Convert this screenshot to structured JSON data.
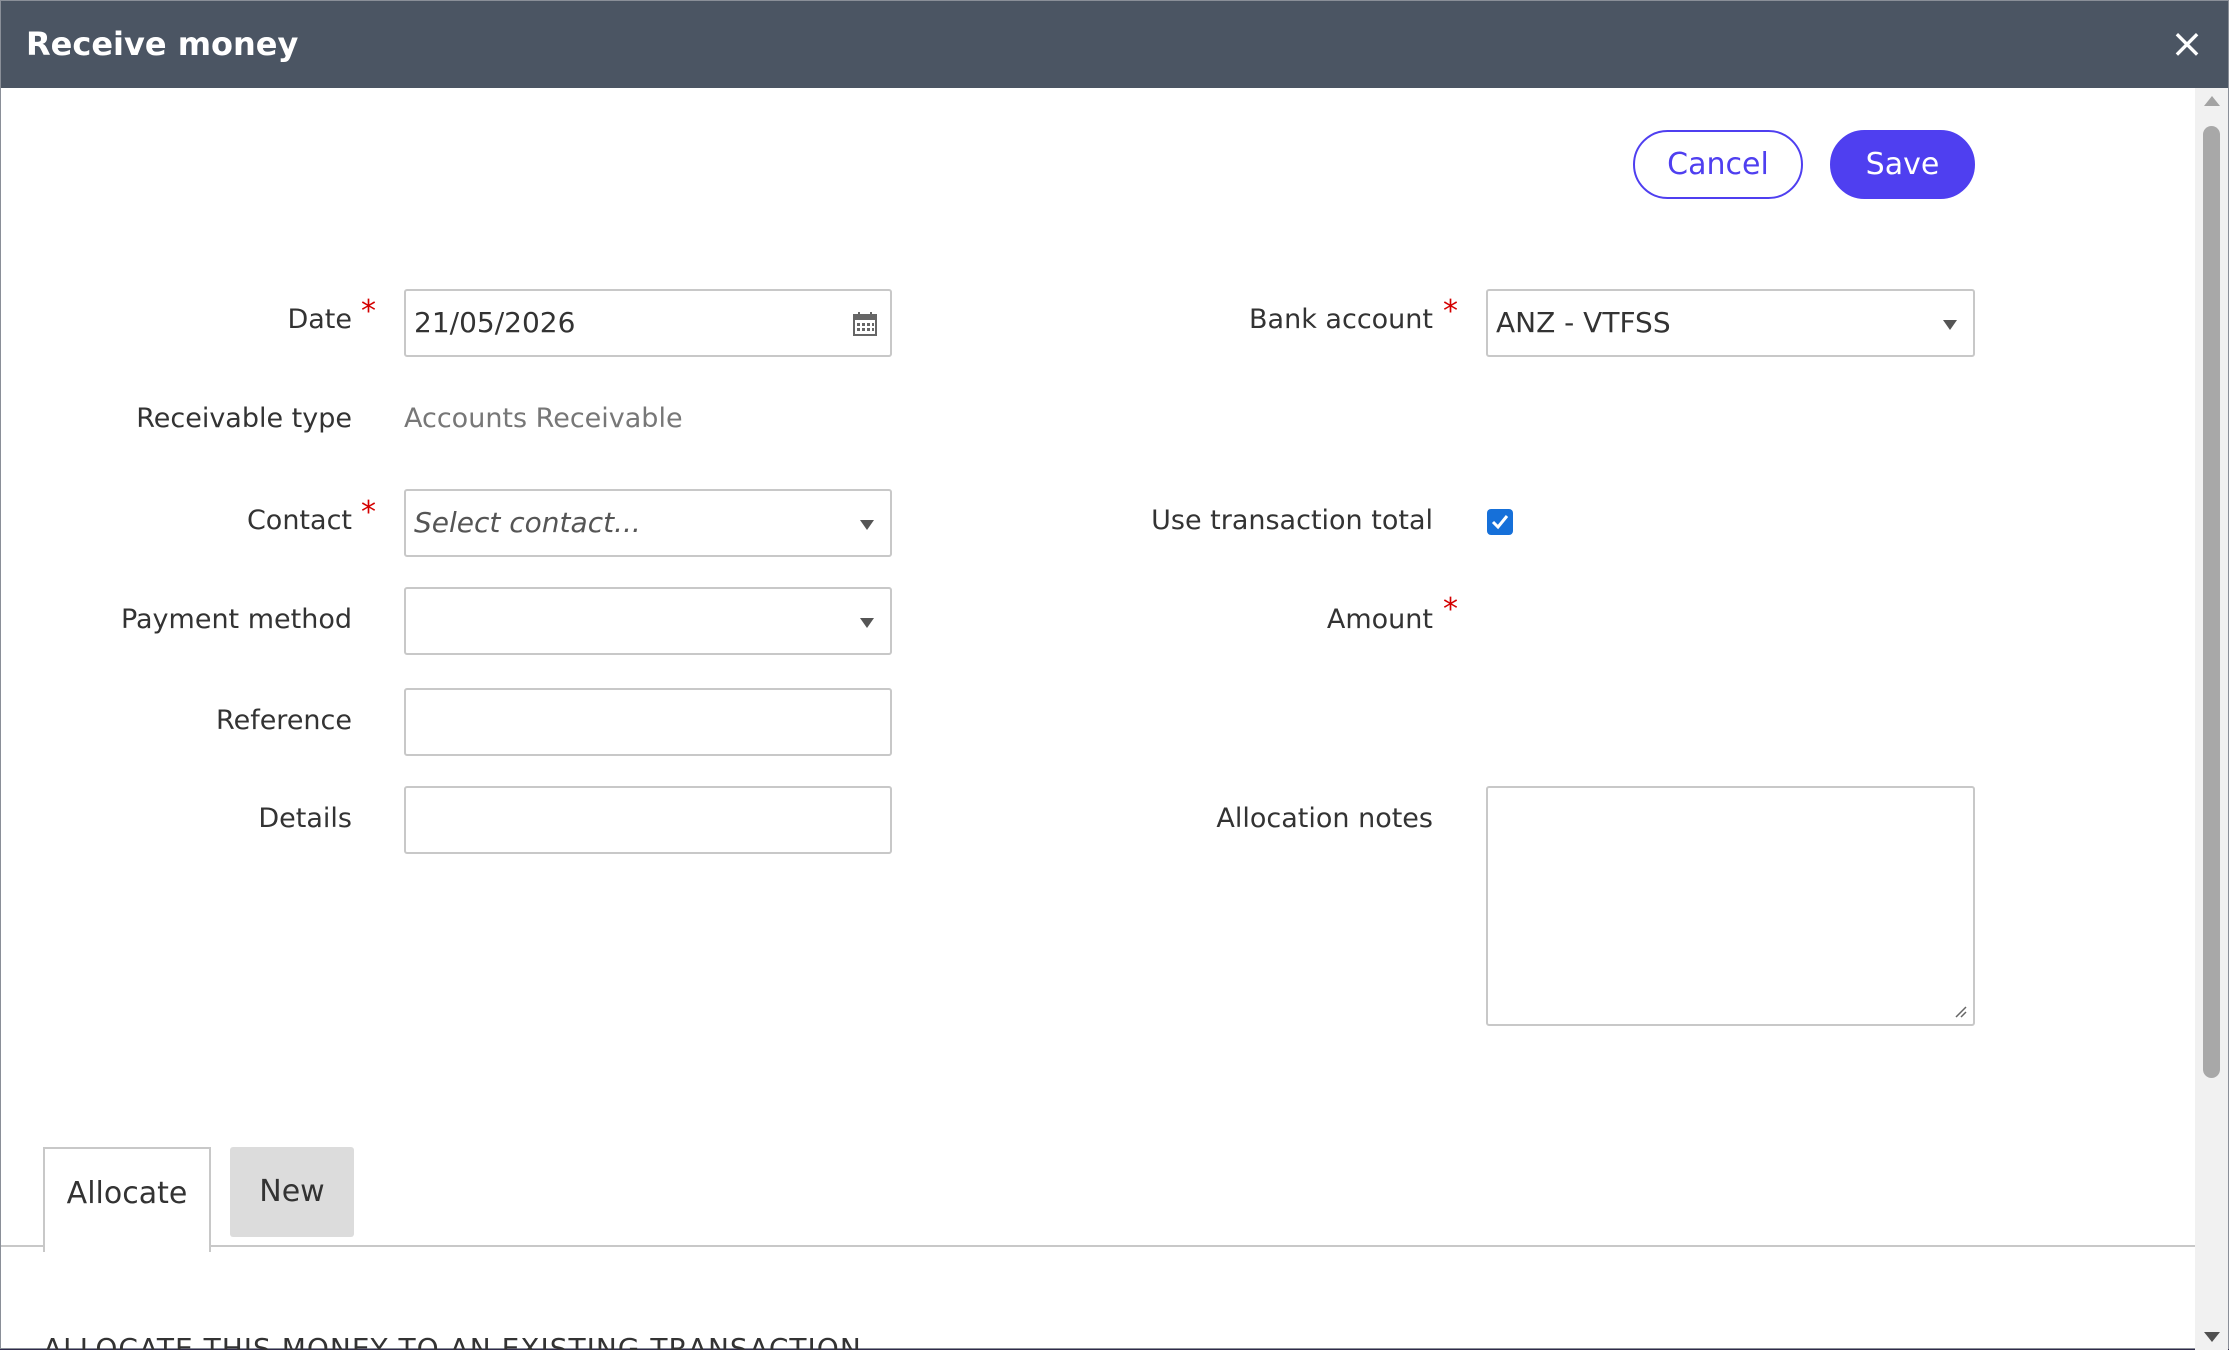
{
  "dialog": {
    "title": "Receive money",
    "close_label": "×"
  },
  "actions": {
    "cancel_label": "Cancel",
    "save_label": "Save"
  },
  "form": {
    "date": {
      "label": "Date",
      "value": "21/05/2026",
      "required": true
    },
    "bank_account": {
      "label": "Bank account",
      "value": "ANZ - VTFSS",
      "required": true
    },
    "receivable_type": {
      "label": "Receivable type",
      "value": "Accounts Receivable"
    },
    "contact": {
      "label": "Contact",
      "placeholder": "Select contact...",
      "required": true
    },
    "use_transaction_total": {
      "label": "Use transaction total",
      "checked": true
    },
    "payment_method": {
      "label": "Payment method",
      "value": ""
    },
    "amount": {
      "label": "Amount",
      "required": true
    },
    "reference": {
      "label": "Reference",
      "value": ""
    },
    "details": {
      "label": "Details",
      "value": ""
    },
    "allocation_notes": {
      "label": "Allocation notes",
      "value": ""
    },
    "required_marker": "*"
  },
  "tabs": [
    {
      "label": "Allocate",
      "active": true
    },
    {
      "label": "New",
      "active": false
    }
  ],
  "allocate_section": {
    "heading": "ALLOCATE THIS MONEY TO AN EXISTING TRANSACTION"
  },
  "colors": {
    "titlebar": "#4b5563",
    "primary": "#4f3ff0",
    "required": "#d40000",
    "checkbox": "#1670d9"
  }
}
